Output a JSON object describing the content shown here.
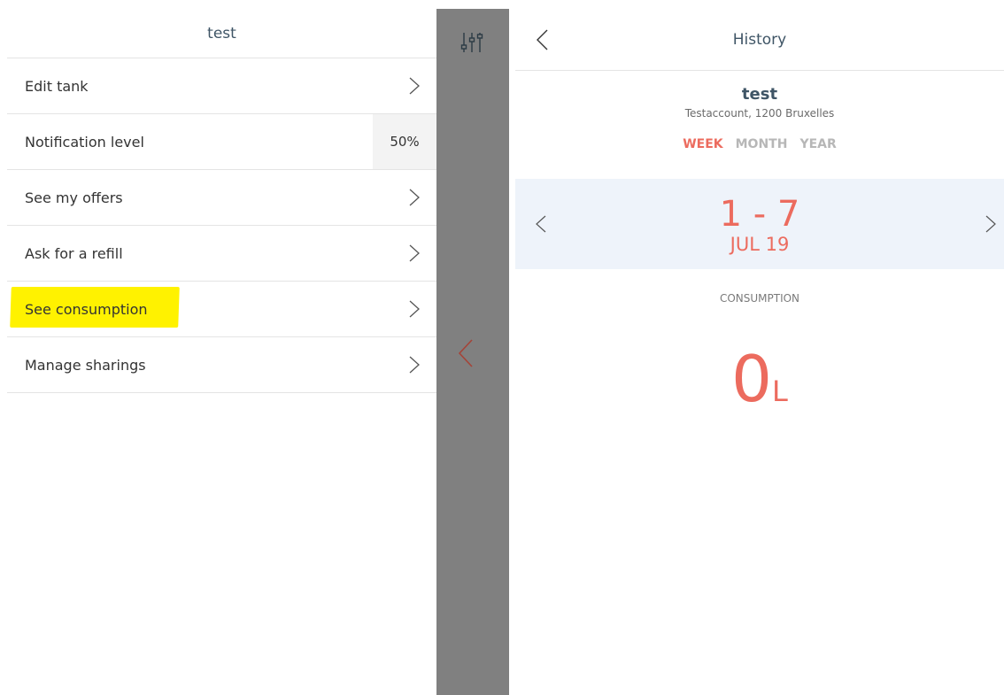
{
  "left": {
    "title": "test",
    "menu": [
      {
        "label": "Edit tank",
        "icon": "chevron-right-icon"
      },
      {
        "label": "Notification level",
        "value": "50%"
      },
      {
        "label": "See my offers",
        "icon": "chevron-right-icon"
      },
      {
        "label": "Ask for a refill",
        "icon": "chevron-right-icon"
      },
      {
        "label": "See consumption",
        "icon": "chevron-right-icon",
        "highlighted": true
      },
      {
        "label": "Manage sharings",
        "icon": "chevron-right-icon"
      }
    ]
  },
  "strip": {
    "top_icon": "filter-sliders-icon",
    "middle_icon": "chevron-left-icon"
  },
  "right": {
    "title": "History",
    "back_icon": "chevron-left-icon",
    "tank_name": "test",
    "tank_address": "Testaccount, 1200 Bruxelles",
    "tabs": [
      {
        "label": "WEEK",
        "active": true
      },
      {
        "label": "MONTH",
        "active": false
      },
      {
        "label": "YEAR",
        "active": false
      }
    ],
    "date_range": "1 - 7",
    "date_month": "JUL 19",
    "consumption_label": "CONSUMPTION",
    "consumption_value": "0",
    "consumption_unit": "L"
  },
  "colors": {
    "accent": "#ec6b5e",
    "title": "#3f5566",
    "highlight": "#fff200",
    "strip": "#808080",
    "date_band": "#eef3fa"
  }
}
